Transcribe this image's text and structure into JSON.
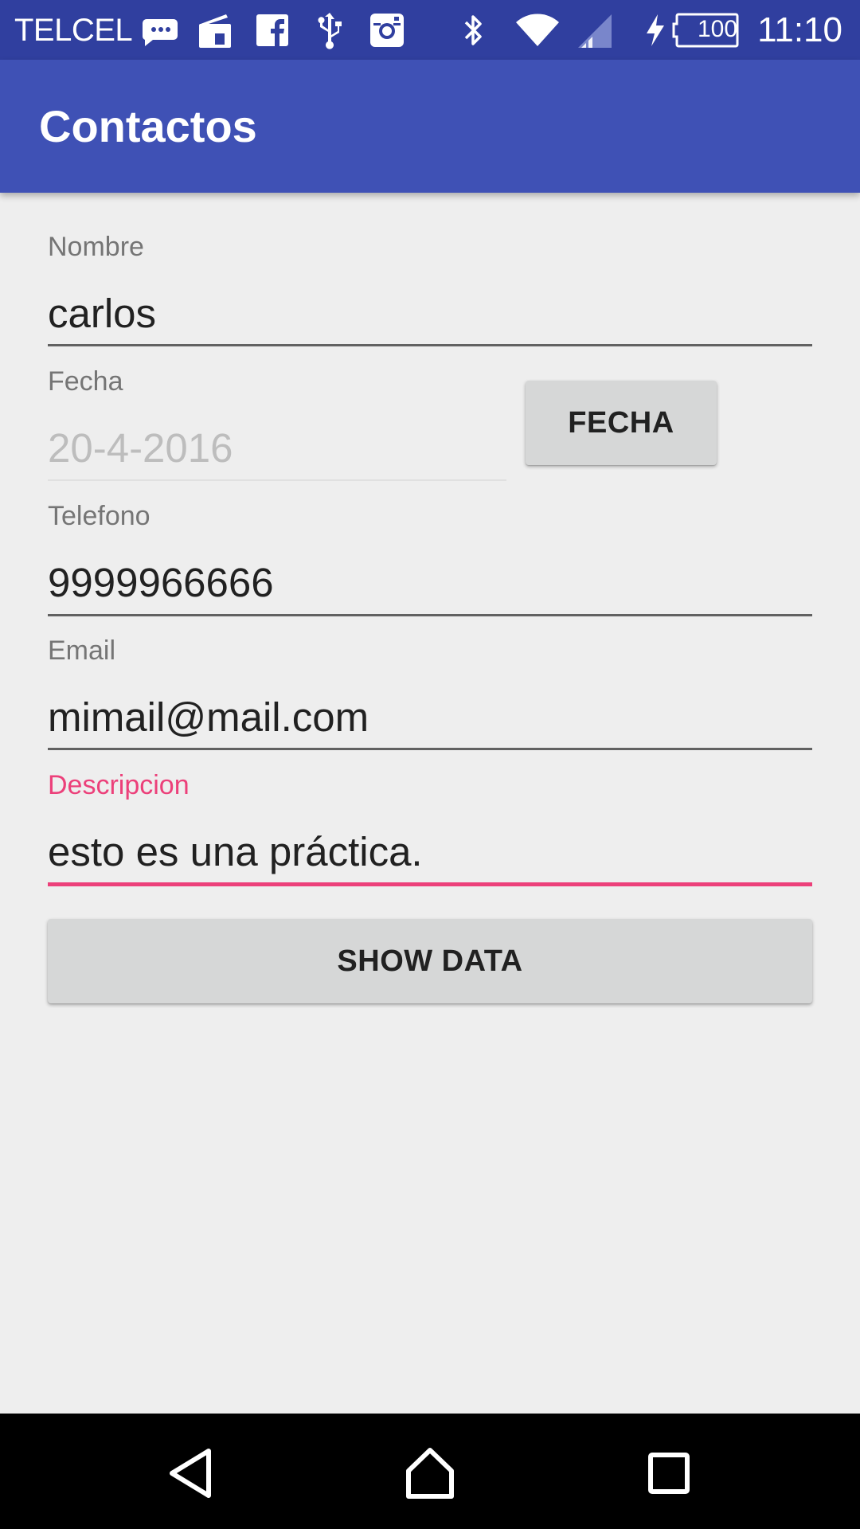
{
  "status_bar": {
    "carrier": "TELCEL",
    "battery_level": "100",
    "time": "11:10",
    "icons": [
      "messaging-icon",
      "radio-icon",
      "facebook-icon",
      "usb-icon",
      "instagram-icon",
      "bluetooth-icon",
      "wifi-icon",
      "cell-signal-icon",
      "charging-icon",
      "battery-icon"
    ]
  },
  "app_bar": {
    "title": "Contactos"
  },
  "form": {
    "nombre": {
      "label": "Nombre",
      "value": "carlos"
    },
    "fecha": {
      "label": "Fecha",
      "value": "20-4-2016",
      "button_label": "FECHA"
    },
    "telefono": {
      "label": "Telefono",
      "value": "9999966666"
    },
    "email": {
      "label": "Email",
      "value": "mimail@mail.com"
    },
    "descripcion": {
      "label": "Descripcion",
      "value": "esto es una práctica."
    },
    "show_data_label": "SHOW DATA"
  },
  "colors": {
    "status_bar": "#303f9f",
    "app_bar": "#3f51b5",
    "accent": "#ec407a",
    "background": "#eeeeee"
  },
  "nav_bar": {
    "icons": [
      "back-icon",
      "home-icon",
      "recents-icon"
    ]
  }
}
